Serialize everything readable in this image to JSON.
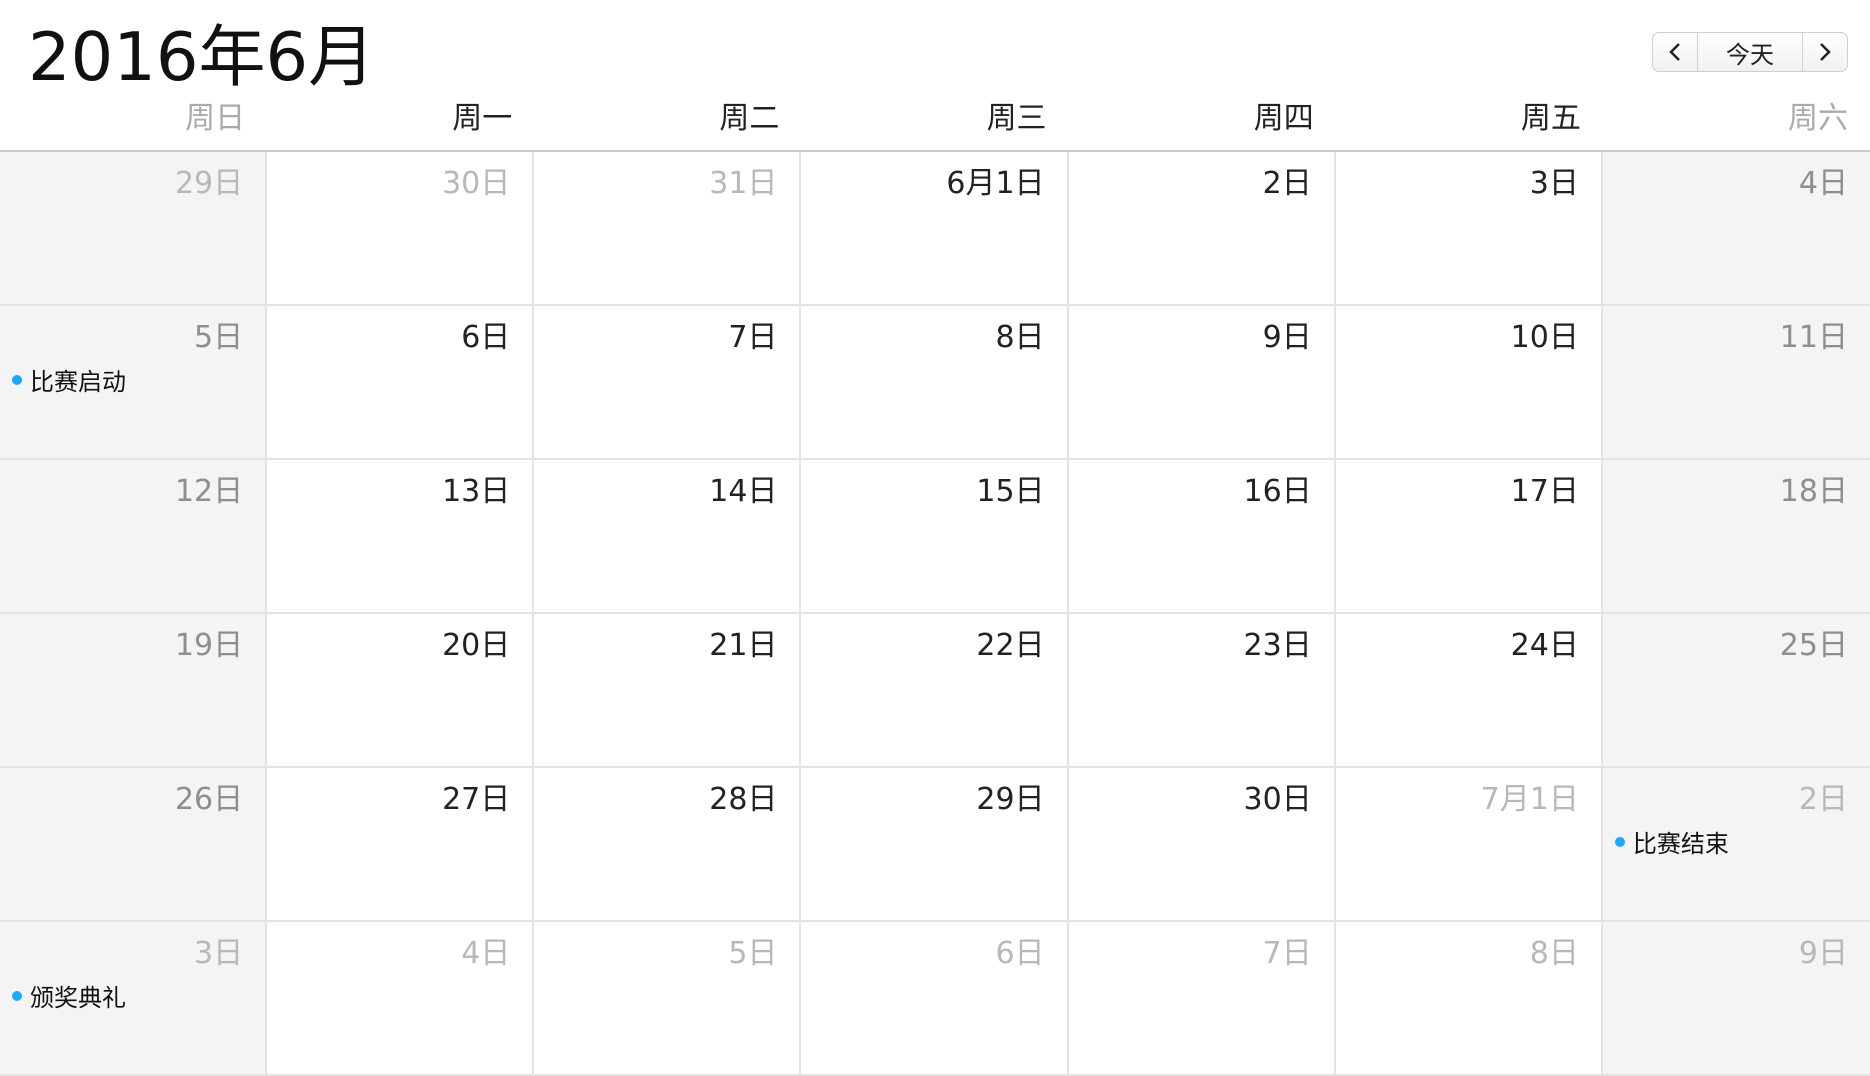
{
  "header": {
    "title": "2016年6月",
    "prev_label": "‹",
    "today_label": "今天",
    "next_label": "›"
  },
  "colors": {
    "accent": "#1ea7ff",
    "weekend_bg": "#f4f4f4"
  },
  "weekdays": [
    {
      "label": "周日",
      "weekend": true
    },
    {
      "label": "周一",
      "weekend": false
    },
    {
      "label": "周二",
      "weekend": false
    },
    {
      "label": "周三",
      "weekend": false
    },
    {
      "label": "周四",
      "weekend": false
    },
    {
      "label": "周五",
      "weekend": false
    },
    {
      "label": "周六",
      "weekend": true
    }
  ],
  "days": [
    {
      "label": "29日",
      "other": true
    },
    {
      "label": "30日",
      "other": true
    },
    {
      "label": "31日",
      "other": true
    },
    {
      "label": "6月1日"
    },
    {
      "label": "2日"
    },
    {
      "label": "3日"
    },
    {
      "label": "4日"
    },
    {
      "label": "5日",
      "event": "比赛启动"
    },
    {
      "label": "6日"
    },
    {
      "label": "7日"
    },
    {
      "label": "8日"
    },
    {
      "label": "9日"
    },
    {
      "label": "10日"
    },
    {
      "label": "11日"
    },
    {
      "label": "12日"
    },
    {
      "label": "13日"
    },
    {
      "label": "14日"
    },
    {
      "label": "15日"
    },
    {
      "label": "16日"
    },
    {
      "label": "17日"
    },
    {
      "label": "18日"
    },
    {
      "label": "19日"
    },
    {
      "label": "20日"
    },
    {
      "label": "21日"
    },
    {
      "label": "22日"
    },
    {
      "label": "23日"
    },
    {
      "label": "24日"
    },
    {
      "label": "25日"
    },
    {
      "label": "26日"
    },
    {
      "label": "27日"
    },
    {
      "label": "28日"
    },
    {
      "label": "29日"
    },
    {
      "label": "30日"
    },
    {
      "label": "7月1日",
      "other": true
    },
    {
      "label": "2日",
      "other": true,
      "event": "比赛结束"
    },
    {
      "label": "3日",
      "other": true,
      "event": "颁奖典礼"
    },
    {
      "label": "4日",
      "other": true
    },
    {
      "label": "5日",
      "other": true
    },
    {
      "label": "6日",
      "other": true
    },
    {
      "label": "7日",
      "other": true
    },
    {
      "label": "8日",
      "other": true
    },
    {
      "label": "9日",
      "other": true
    }
  ]
}
